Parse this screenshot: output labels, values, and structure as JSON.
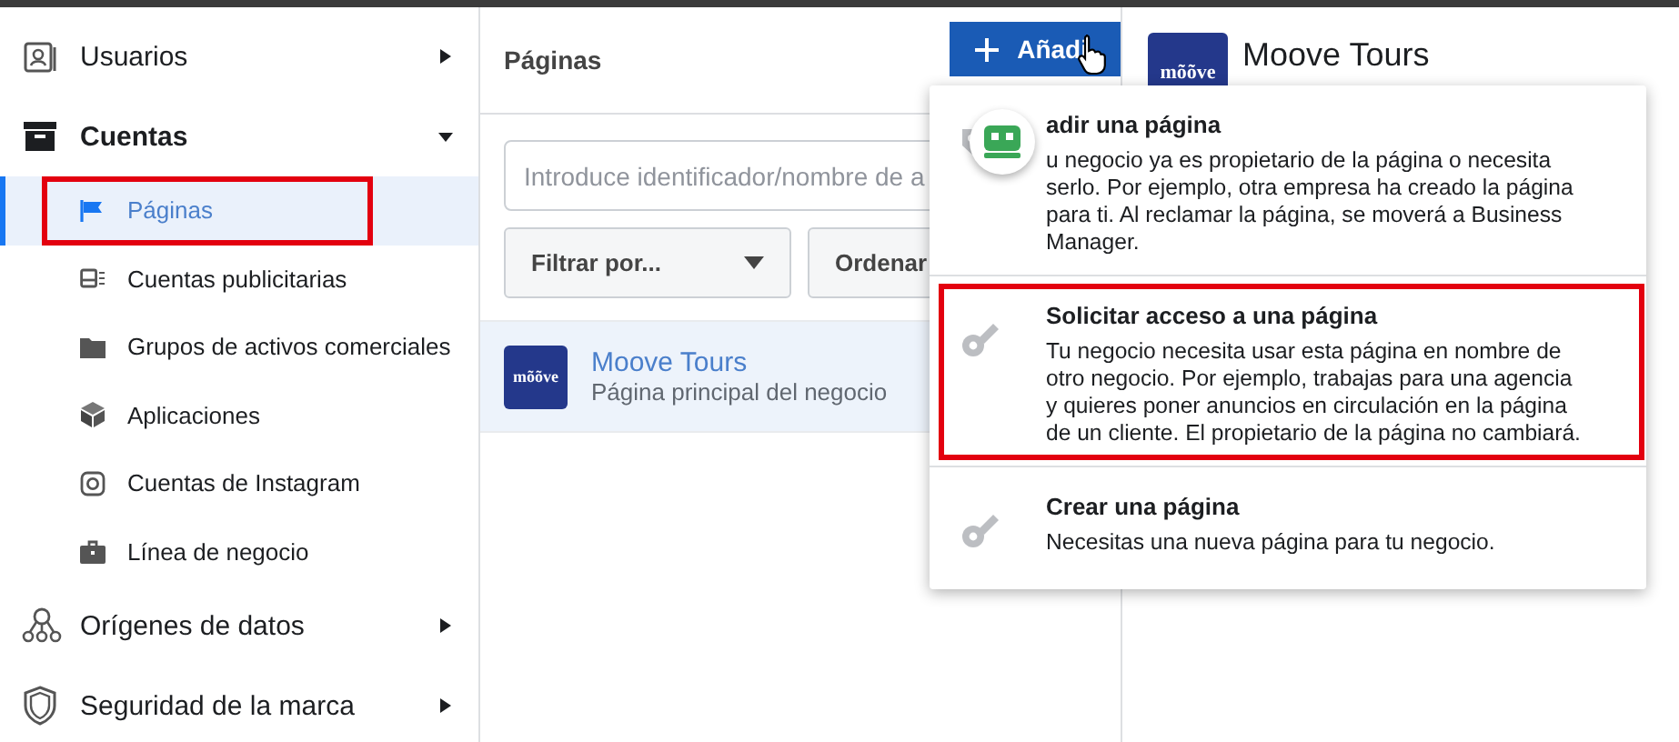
{
  "sidebar": {
    "items": [
      {
        "label": "Usuarios",
        "expanded": false
      },
      {
        "label": "Cuentas",
        "expanded": true,
        "children": [
          {
            "label": "Páginas",
            "selected": true,
            "highlighted": true
          },
          {
            "label": "Cuentas publicitarias",
            "selected": false,
            "highlighted": false
          },
          {
            "label": "Grupos de activos comerciales",
            "selected": false,
            "highlighted": false
          },
          {
            "label": "Aplicaciones",
            "selected": false,
            "highlighted": false
          },
          {
            "label": "Cuentas de Instagram",
            "selected": false,
            "highlighted": false
          },
          {
            "label": "Línea de negocio",
            "selected": false,
            "highlighted": false
          }
        ]
      },
      {
        "label": "Orígenes de datos",
        "expanded": false
      },
      {
        "label": "Seguridad de la marca",
        "expanded": false
      }
    ]
  },
  "pages_panel": {
    "title": "Páginas",
    "add_button": "Añadi",
    "search": {
      "placeholder": "Introduce identificador/nombre de a"
    },
    "filter": "Filtrar por...",
    "sort": "Ordenar",
    "list": [
      {
        "logo": "mõõve",
        "name": "Moove Tours",
        "subtitle": "Página principal del negocio",
        "selected": true
      }
    ]
  },
  "detail": {
    "logo": "mõõve",
    "name": "Moove Tours"
  },
  "add_menu": {
    "options": [
      {
        "kind": "tag",
        "title": "adir una página",
        "description": "u negocio ya es propietario de la página o necesita serlo. Por ejemplo, otra empresa ha creado la página para ti. Al reclamar la página, se moverá a Business Manager.",
        "highlighted": false
      },
      {
        "kind": "key",
        "title": "Solicitar acceso a una página",
        "description": "Tu negocio necesita usar esta página en nombre de otro negocio. Por ejemplo, trabajas para una agencia y quieres poner anuncios en circulación en la página de un cliente. El propietario de la página no cambiará.",
        "highlighted": true
      },
      {
        "kind": "key",
        "title": "Crear una página",
        "description": "Necesitas una nueva página para tu negocio.",
        "highlighted": false
      }
    ]
  }
}
